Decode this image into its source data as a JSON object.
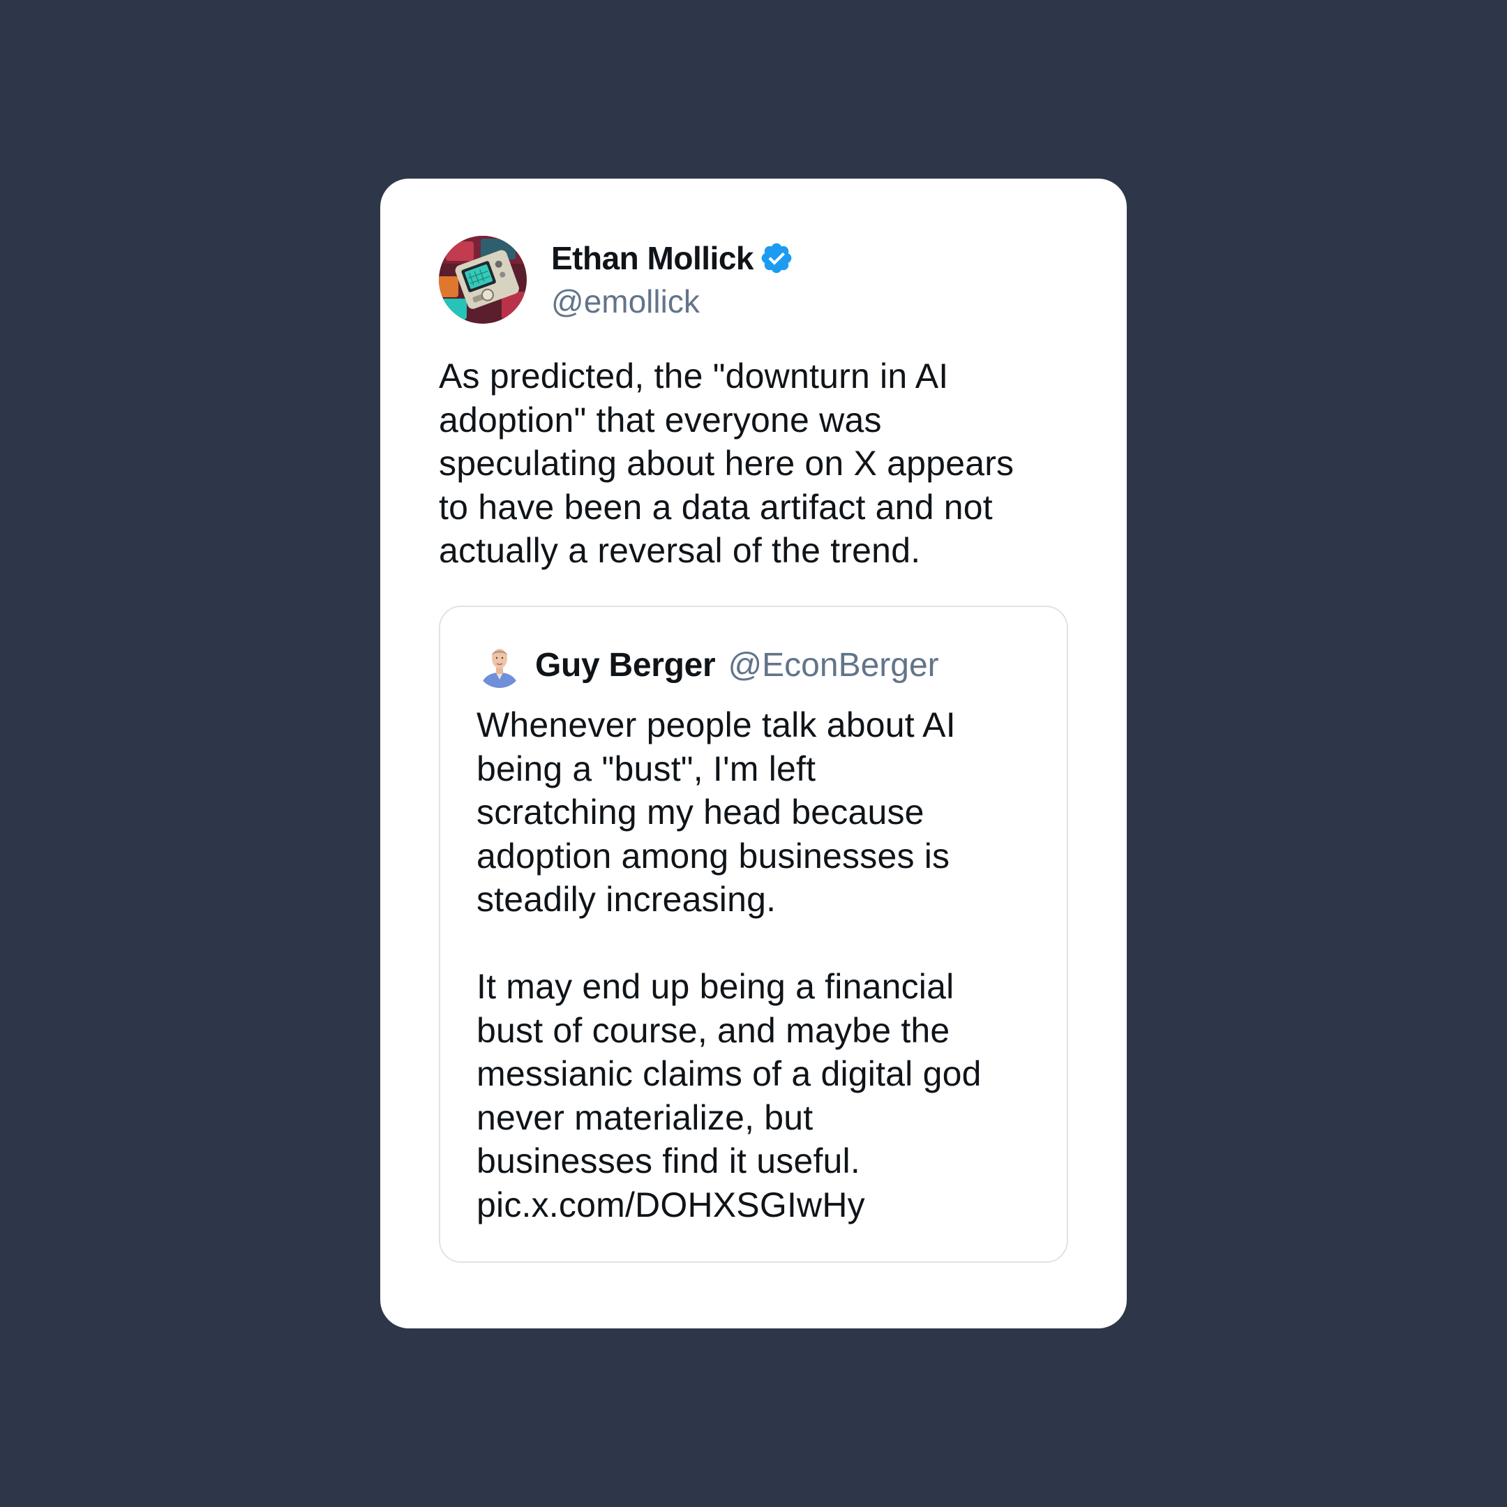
{
  "colors": {
    "background": "#2e3749",
    "card": "#ffffff",
    "text_primary": "#0f1419",
    "text_secondary": "#62748a",
    "verified_badge": "#1d9bf0",
    "quote_border": "#dfe3e8"
  },
  "tweet": {
    "author": {
      "name": "Ethan Mollick",
      "handle": "@emollick",
      "verified": true,
      "avatar_icon": "retro-game-device-avatar",
      "verified_icon": "verified-badge-icon"
    },
    "text": "As predicted, the \"downturn in AI\nadoption\" that everyone was\nspeculating about here on X appears\nto have been a data artifact and not\nactually a reversal of the trend."
  },
  "quoted_tweet": {
    "author": {
      "name": "Guy Berger",
      "handle": "@EconBerger",
      "avatar_icon": "person-photo-avatar"
    },
    "text": "Whenever people talk about AI\nbeing a \"bust\", I'm left\nscratching my head because\nadoption among businesses is\nsteadily increasing.\n\nIt may end up being a financial\nbust of course, and maybe the\nmessianic claims of a digital god\nnever materialize, but\nbusinesses find it useful.\npic.x.com/DOHXSGIwHy"
  }
}
